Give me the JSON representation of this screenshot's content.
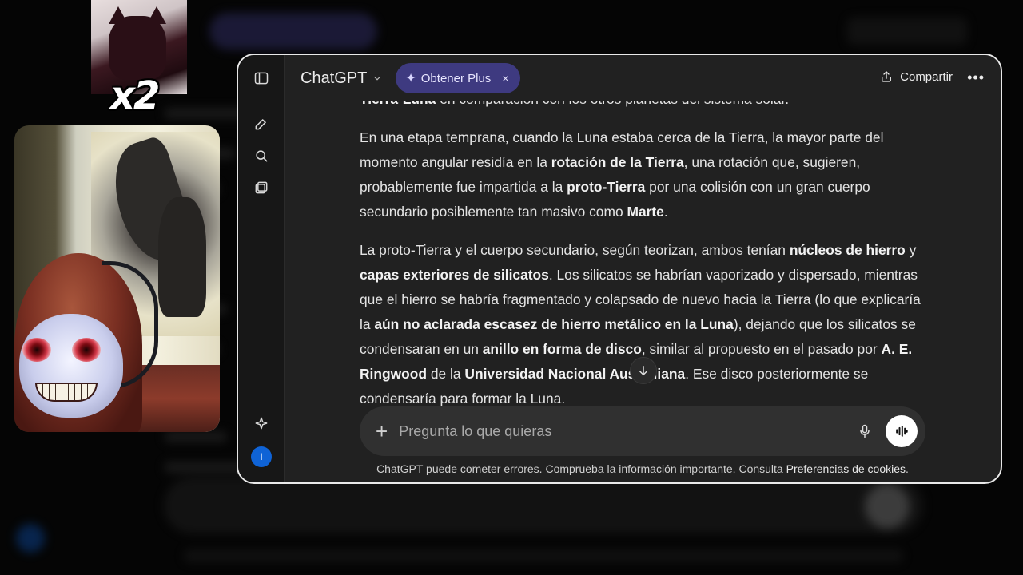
{
  "app": {
    "title": "ChatGPT"
  },
  "header": {
    "upsell_label": "Obtener Plus",
    "upsell_close": "×",
    "share_label": "Compartir",
    "more_label": "•••"
  },
  "overlay": {
    "multiplier": "x2"
  },
  "user": {
    "initial": "I"
  },
  "message": {
    "p0_b1": "Tierra-Luna",
    "p0_t1": " en comparación con los otros planetas del sistema solar.",
    "p1_t1": "En una etapa temprana, cuando la Luna estaba cerca de la Tierra, la mayor parte del momento angular residía en la ",
    "p1_b1": "rotación de la Tierra",
    "p1_t2": ", una rotación que, sugieren, probablemente fue impartida a la ",
    "p1_b2": "proto-Tierra",
    "p1_t3": " por una colisión con un gran cuerpo secundario posiblemente tan masivo como ",
    "p1_b3": "Marte",
    "p1_t4": ".",
    "p2_t1": "La proto-Tierra y el cuerpo secundario, según teorizan, ambos tenían ",
    "p2_b1": "núcleos de hierro",
    "p2_t2": " y ",
    "p2_b2": "capas exteriores de silicatos",
    "p2_t3": ". Los silicatos se habrían vaporizado y dispersado, mientras que el hierro se habría fragmentado y colapsado de nuevo hacia la Tierra (lo que explicaría la ",
    "p2_b3": "aún no aclarada escasez de hierro metálico en la Luna",
    "p2_t4": "), dejando que los silicatos se condensaran en un ",
    "p2_b4": "anillo en forma de disco",
    "p2_t5": ", similar al propuesto en el pasado por ",
    "p2_b5": "A. E. Ringwood",
    "p2_t6": " de la ",
    "p2_b6": "Universidad Nacional Australiana",
    "p2_t7": ". Ese disco posteriormente se condensaría para formar la Luna."
  },
  "composer": {
    "placeholder": "Pregunta lo que quieras",
    "plus_label": "+"
  },
  "footer": {
    "note": "ChatGPT puede cometer errores. Comprueba la información importante. Consulta ",
    "link": "Preferencias de cookies",
    "end": "."
  },
  "colors": {
    "upsell_bg": "#3e3a80",
    "avatar": "#0f63d6",
    "panel": "#212121"
  }
}
